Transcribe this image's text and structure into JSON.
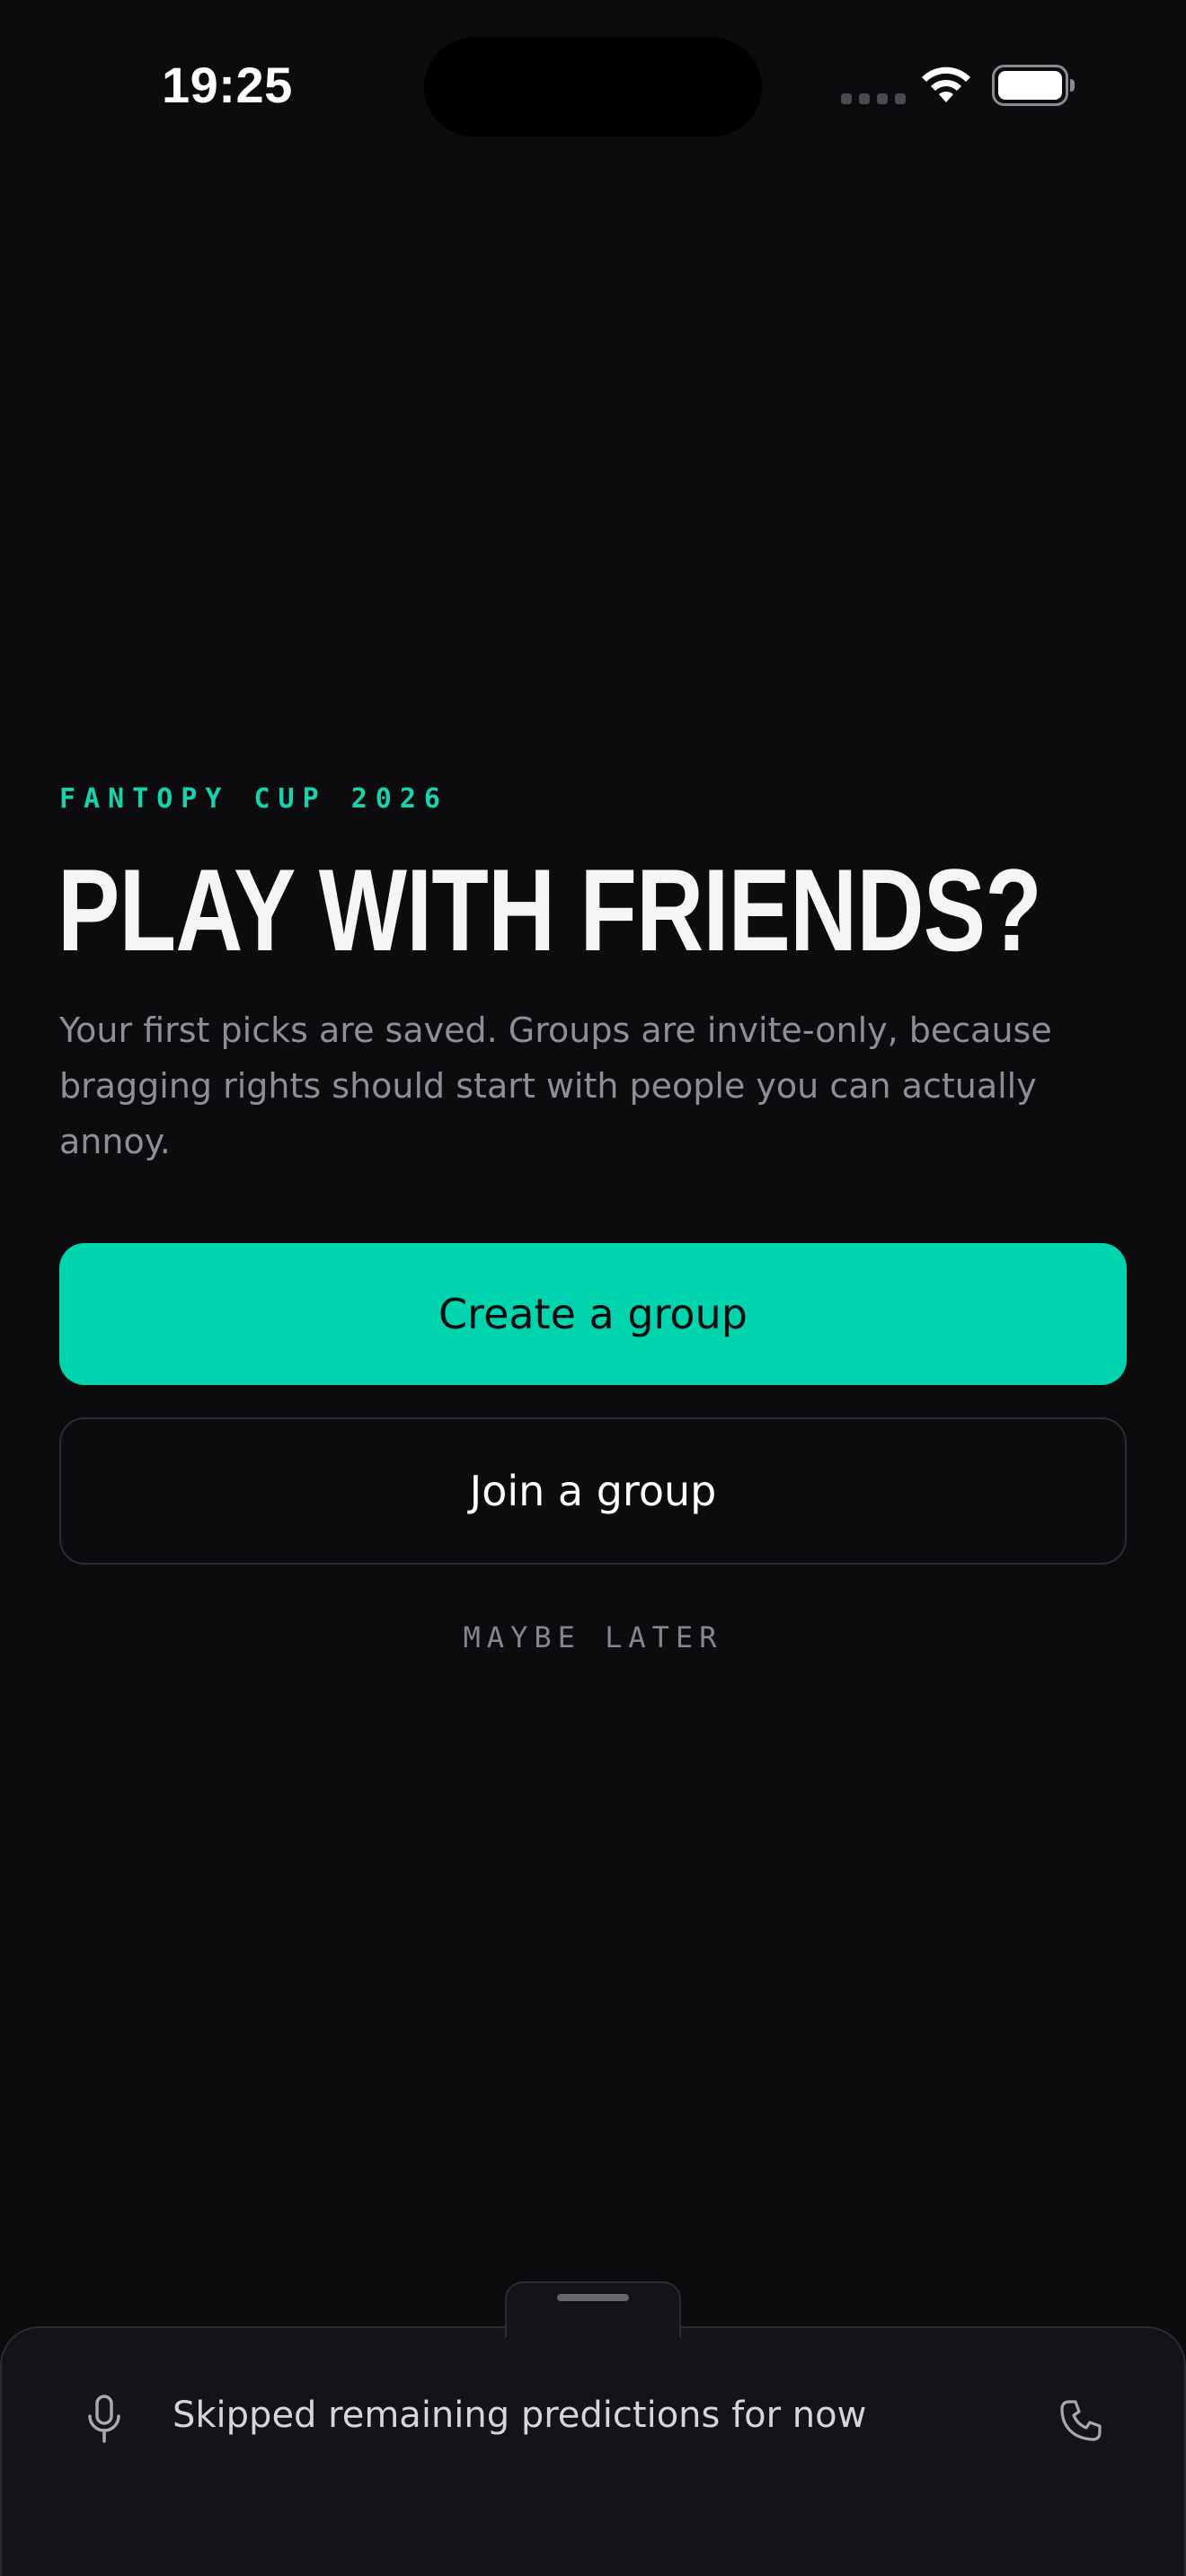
{
  "status_bar": {
    "time": "19:25"
  },
  "main": {
    "eyebrow": "FANTOPY CUP 2026",
    "headline": "PLAY WITH FRIENDS?",
    "subtitle": "Your first picks are saved. Groups are invite-only, because bragging rights should start with people you can actually annoy.",
    "primary_button": "Create a group",
    "secondary_button": "Join a group",
    "tertiary_link": "MAYBE LATER"
  },
  "bottom_sheet": {
    "status_text": "Skipped remaining predictions for now",
    "left_icon": "microphone-icon",
    "right_icon": "phone-icon"
  },
  "colors": {
    "background": "#0c0c0f",
    "accent": "#00d4ae",
    "eyebrow": "#17d3ad",
    "muted_text": "#8e8e95",
    "sheet_background": "#131318"
  }
}
